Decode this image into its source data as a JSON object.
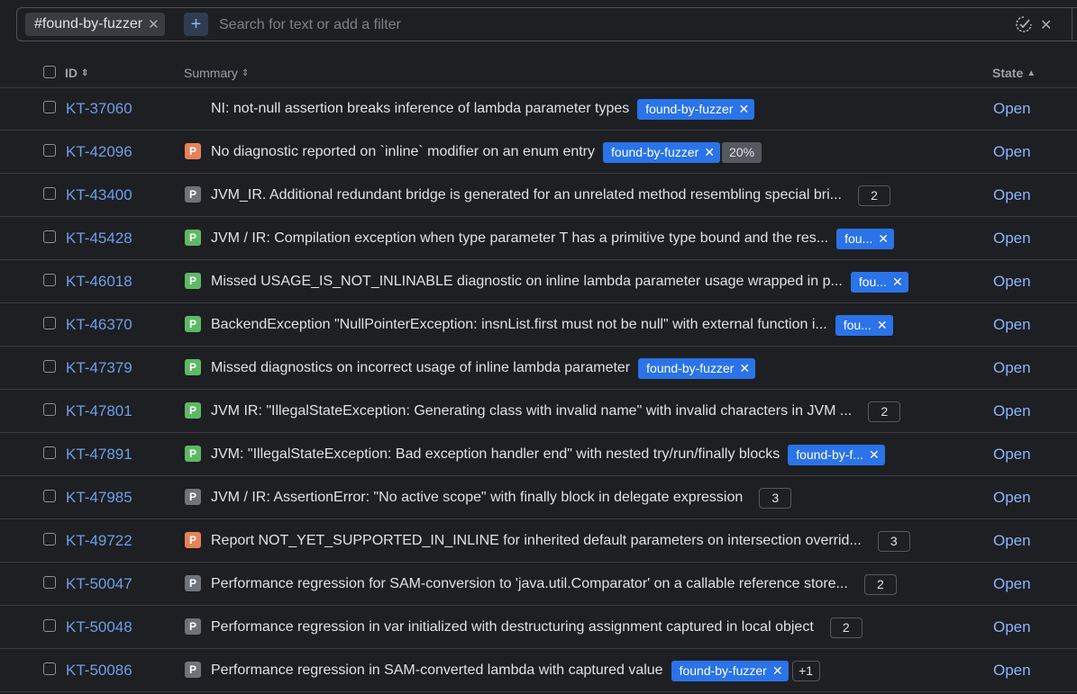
{
  "search": {
    "chip_label": "#found-by-fuzzer",
    "add_label": "+",
    "placeholder": "Search for text or add a filter",
    "value": ""
  },
  "columns": {
    "id": "ID",
    "summary": "Summary",
    "state": "State"
  },
  "colors": {
    "background": "#1e1f22",
    "link": "#6d9ee8",
    "state": "#8cb4ff",
    "tag": "#2a73e8",
    "priority_orange": "#e5825a",
    "priority_green": "#5fb865",
    "priority_gray": "#6f737a"
  },
  "rows": [
    {
      "id": "KT-37060",
      "priority": "",
      "priority_color": "",
      "summary": "NI: not-null assertion breaks inference of lambda parameter types",
      "tag": "found-by-fuzzer",
      "pct": "",
      "count": "",
      "extra": "",
      "state": "Open"
    },
    {
      "id": "KT-42096",
      "priority": "P",
      "priority_color": "orange",
      "summary": "No diagnostic reported on `inline` modifier on an enum entry",
      "tag": "found-by-fuzzer",
      "pct": "20%",
      "count": "",
      "extra": "",
      "state": "Open"
    },
    {
      "id": "KT-43400",
      "priority": "P",
      "priority_color": "gray",
      "summary": "JVM_IR. Additional redundant bridge is generated for an unrelated method resembling special bri...",
      "tag": "",
      "pct": "",
      "count": "2",
      "extra": "",
      "state": "Open"
    },
    {
      "id": "KT-45428",
      "priority": "P",
      "priority_color": "green",
      "summary": "JVM / IR: Compilation exception when type parameter T has a primitive type bound and the res...",
      "tag": "fou...",
      "pct": "",
      "count": "",
      "extra": "",
      "state": "Open"
    },
    {
      "id": "KT-46018",
      "priority": "P",
      "priority_color": "green",
      "summary": "Missed USAGE_IS_NOT_INLINABLE diagnostic on inline lambda parameter usage wrapped in p...",
      "tag": "fou...",
      "pct": "",
      "count": "",
      "extra": "",
      "state": "Open"
    },
    {
      "id": "KT-46370",
      "priority": "P",
      "priority_color": "green",
      "summary": "BackendException \"NullPointerException: insnList.first must not be null\" with external function i...",
      "tag": "fou...",
      "pct": "",
      "count": "",
      "extra": "",
      "state": "Open"
    },
    {
      "id": "KT-47379",
      "priority": "P",
      "priority_color": "green",
      "summary": "Missed diagnostics on incorrect usage of inline lambda parameter",
      "tag": "found-by-fuzzer",
      "pct": "",
      "count": "",
      "extra": "",
      "state": "Open"
    },
    {
      "id": "KT-47801",
      "priority": "P",
      "priority_color": "green",
      "summary": "JVM IR: \"IllegalStateException: Generating class with invalid name\" with invalid characters in JVM ...",
      "tag": "",
      "pct": "",
      "count": "2",
      "extra": "",
      "state": "Open"
    },
    {
      "id": "KT-47891",
      "priority": "P",
      "priority_color": "green",
      "summary": "JVM: \"IllegalStateException: Bad exception handler end\" with nested try/run/finally blocks",
      "tag": "found-by-f...",
      "pct": "",
      "count": "",
      "extra": "",
      "state": "Open"
    },
    {
      "id": "KT-47985",
      "priority": "P",
      "priority_color": "gray",
      "summary": "JVM / IR: AssertionError: \"No active scope\" with finally block in delegate expression",
      "tag": "",
      "pct": "",
      "count": "3",
      "extra": "",
      "state": "Open"
    },
    {
      "id": "KT-49722",
      "priority": "P",
      "priority_color": "orange",
      "summary": "Report NOT_YET_SUPPORTED_IN_INLINE for inherited default parameters on intersection overrid...",
      "tag": "",
      "pct": "",
      "count": "3",
      "extra": "",
      "state": "Open"
    },
    {
      "id": "KT-50047",
      "priority": "P",
      "priority_color": "gray",
      "summary": "Performance regression for SAM-conversion to 'java.util.Comparator' on a callable reference store...",
      "tag": "",
      "pct": "",
      "count": "2",
      "extra": "",
      "state": "Open"
    },
    {
      "id": "KT-50048",
      "priority": "P",
      "priority_color": "gray",
      "summary": "Performance regression in var initialized with destructuring assignment captured in local object",
      "tag": "",
      "pct": "",
      "count": "2",
      "extra": "",
      "state": "Open"
    },
    {
      "id": "KT-50086",
      "priority": "P",
      "priority_color": "gray",
      "summary": "Performance regression in SAM-converted lambda with captured value",
      "tag": "found-by-fuzzer",
      "pct": "",
      "count": "",
      "extra": "+1",
      "state": "Open"
    }
  ]
}
